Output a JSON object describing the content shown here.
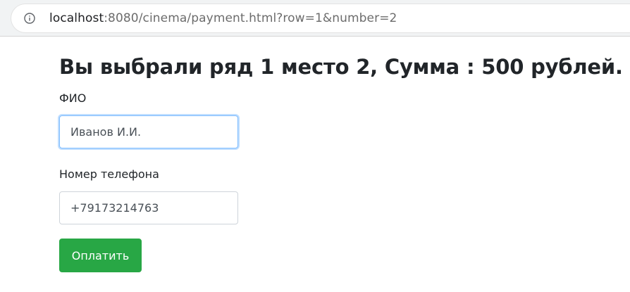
{
  "browser": {
    "url_host": "localhost",
    "url_rest": ":8080/cinema/payment.html?row=1&number=2"
  },
  "page": {
    "heading": "Вы выбрали ряд 1 место 2, Сумма : 500 рублей.",
    "name_label": "ФИО",
    "name_value": "Иванов И.И.",
    "phone_label": "Номер телефона",
    "phone_value": "+79173214763",
    "pay_button": "Оплатить"
  },
  "colors": {
    "button": "#28a745",
    "focus_border": "#80bdff",
    "text": "#212529"
  },
  "icons": {
    "address_bar": "info-icon"
  }
}
